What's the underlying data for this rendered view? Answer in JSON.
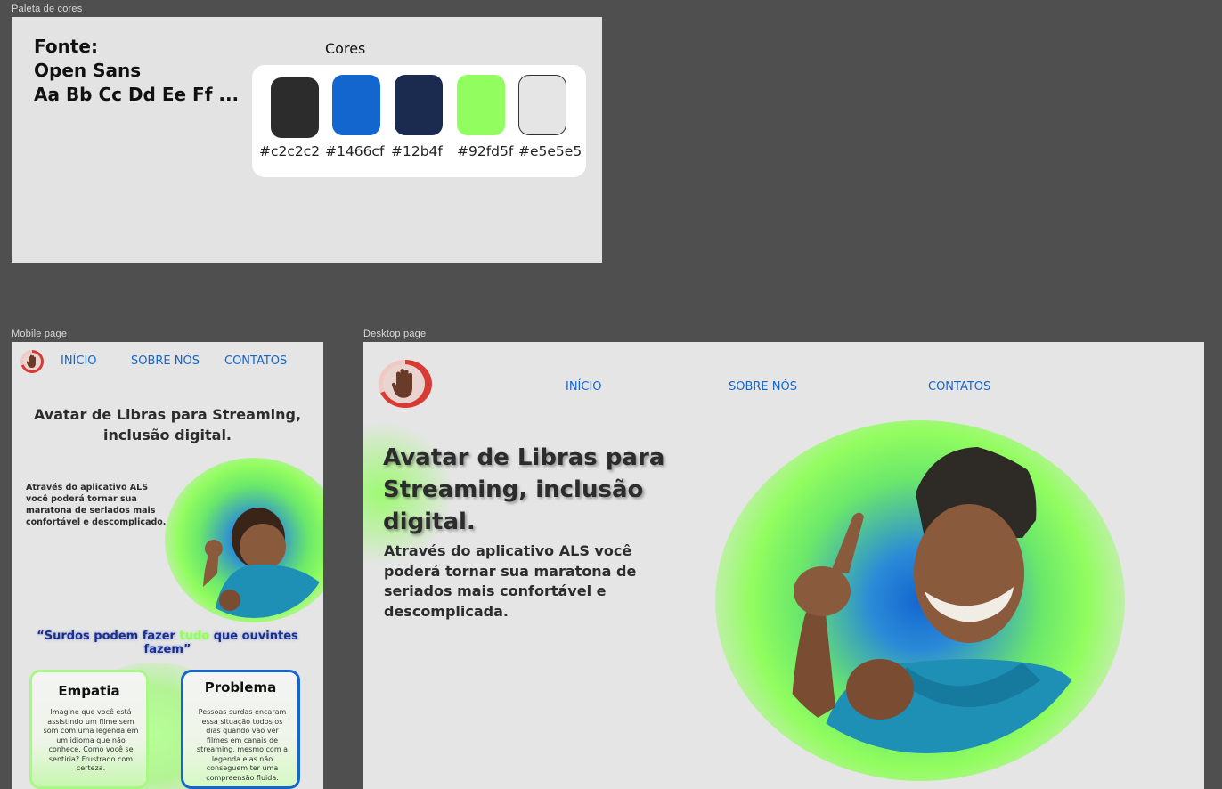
{
  "frames": {
    "palette_label": "Paleta de cores",
    "mobile_label": "Mobile page",
    "desktop_label": "Desktop page"
  },
  "palette": {
    "font_heading": "Fonte:",
    "font_name": "Open Sans",
    "font_sample": "Aa Bb Cc Dd Ee Ff ...",
    "colors_title": "Cores",
    "swatches": [
      {
        "hex": "#c2c2c2",
        "color": "#2c2c2c"
      },
      {
        "hex": "#1466cf",
        "color": "#1466cf"
      },
      {
        "hex": "#12b4f",
        "color": "#1b2a4f"
      },
      {
        "hex": "#92fd5f",
        "color": "#92fd5f"
      },
      {
        "hex": "#e5e5e5",
        "color": "#e5e5e5"
      }
    ]
  },
  "nav": {
    "home": "INÍCIO",
    "about": "SOBRE NÓS",
    "contacts": "CONTATOS"
  },
  "mobile": {
    "title": "Avatar de Libras para Streaming, inclusão digital.",
    "description": "Através do aplicativo ALS você poderá tornar sua maratona de seriados mais confortável e descomplicado.",
    "quote_part1": "“Surdos podem fazer ",
    "quote_part2": "tudo",
    "quote_part3": " que ouvintes fazem”",
    "card1_title": "Empatia",
    "card1_text": "Imagine que você está assistindo um filme sem som com uma legenda em um idioma que não conhece. Como você se sentiria? Frustrado com certeza.",
    "card2_title": "Problema",
    "card2_text": "Pessoas surdas encaram essa situação todos os dias quando vão ver filmes em canais de streaming, mesmo com a legenda elas não conseguem ter uma compreensão fluida."
  },
  "desktop": {
    "title": "Avatar de Libras para Streaming, inclusão digital.",
    "description": "Através do aplicativo ALS você poderá tornar sua maratona de seriados mais confortável e descomplicada."
  },
  "colors": {
    "dark": "#2c2c2c",
    "blue": "#1466cf",
    "navy": "#1b2a4f",
    "green": "#92fd5f",
    "light": "#e5e5e5"
  }
}
